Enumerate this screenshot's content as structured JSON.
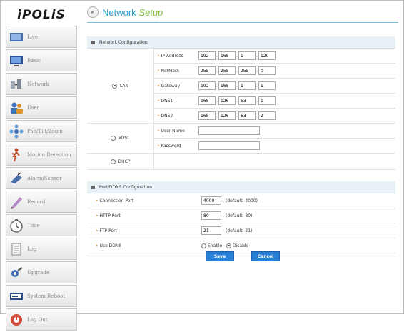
{
  "logo": "iPOLiS",
  "header": {
    "title_a": "Network",
    "title_b": "Setup"
  },
  "sidebar": {
    "items": [
      {
        "label": "Live",
        "icon": "live-icon"
      },
      {
        "label": "Basic",
        "icon": "basic-icon"
      },
      {
        "label": "Network",
        "icon": "network-icon"
      },
      {
        "label": "User",
        "icon": "user-icon"
      },
      {
        "label": "Pan/Tilt/Zoom",
        "icon": "ptz-icon"
      },
      {
        "label": "Motion Detection",
        "icon": "motion-icon"
      },
      {
        "label": "Alarm/Sensor",
        "icon": "alarm-icon"
      },
      {
        "label": "Record",
        "icon": "record-icon"
      },
      {
        "label": "Time",
        "icon": "clock-icon"
      },
      {
        "label": "Log",
        "icon": "log-icon"
      },
      {
        "label": "Upgrade",
        "icon": "upgrade-icon"
      },
      {
        "label": "System Reboot",
        "icon": "reboot-icon"
      },
      {
        "label": "Log Out",
        "icon": "logout-icon"
      }
    ]
  },
  "network": {
    "title": "Network Configuration",
    "lan_label": "LAN",
    "xdsl_label": "xDSL",
    "dhcp_label": "DHCP",
    "selected": "LAN",
    "fields": {
      "ip_label": "IP Address",
      "ip": [
        "192",
        "168",
        "1",
        "120"
      ],
      "netmask_label": "NetMask",
      "netmask": [
        "255",
        "255",
        "255",
        "0"
      ],
      "gateway_label": "Gateway",
      "gateway": [
        "192",
        "168",
        "1",
        "1"
      ],
      "dns1_label": "DNS1",
      "dns1": [
        "168",
        "126",
        "63",
        "1"
      ],
      "dns2_label": "DNS2",
      "dns2": [
        "168",
        "126",
        "63",
        "2"
      ],
      "username_label": "User Name",
      "username": "",
      "password_label": "Password",
      "password": ""
    }
  },
  "ports": {
    "title": "Port/DDNS Configuration",
    "connection_label": "Connection Port",
    "connection": "4000",
    "connection_default": "(default: 4000)",
    "http_label": "HTTP Port",
    "http": "80",
    "http_default": "(default: 80)",
    "ftp_label": "FTP Port",
    "ftp": "21",
    "ftp_default": "(default: 21)",
    "ddns_label": "Use DDNS",
    "enable_label": "Enable",
    "disable_label": "Disable",
    "ddns_selected": "Disable"
  },
  "buttons": {
    "save": "Save",
    "cancel": "Cancel"
  },
  "colors": {
    "accent": "#2a9ad0",
    "button": "#2a7fd6",
    "bullet": "#e0902e",
    "section_bg": "#e8f1f6"
  }
}
